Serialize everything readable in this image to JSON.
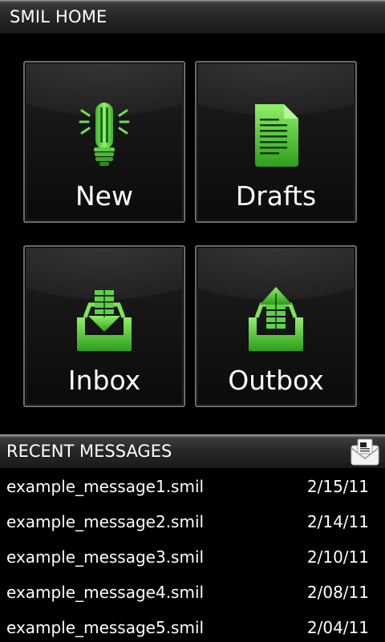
{
  "header": {
    "title": "SMIL HOME"
  },
  "tiles": [
    {
      "id": "new",
      "label": "New",
      "icon": "lightbulb-icon"
    },
    {
      "id": "drafts",
      "label": "Drafts",
      "icon": "document-icon"
    },
    {
      "id": "inbox",
      "label": "Inbox",
      "icon": "inbox-download-icon"
    },
    {
      "id": "outbox",
      "label": "Outbox",
      "icon": "outbox-upload-icon"
    }
  ],
  "recent": {
    "title": "RECENT MESSAGES",
    "icon": "mail-icon",
    "messages": [
      {
        "name": "example_message1.smil",
        "date": "2/15/11"
      },
      {
        "name": "example_message2.smil",
        "date": "2/14/11"
      },
      {
        "name": "example_message3.smil",
        "date": "2/10/11"
      },
      {
        "name": "example_message4.smil",
        "date": "2/08/11"
      },
      {
        "name": "example_message5.smil",
        "date": "2/04/11"
      }
    ]
  },
  "colors": {
    "accent_green": "#5fd04a",
    "accent_green_dark": "#2f9a1f",
    "background": "#000000"
  }
}
